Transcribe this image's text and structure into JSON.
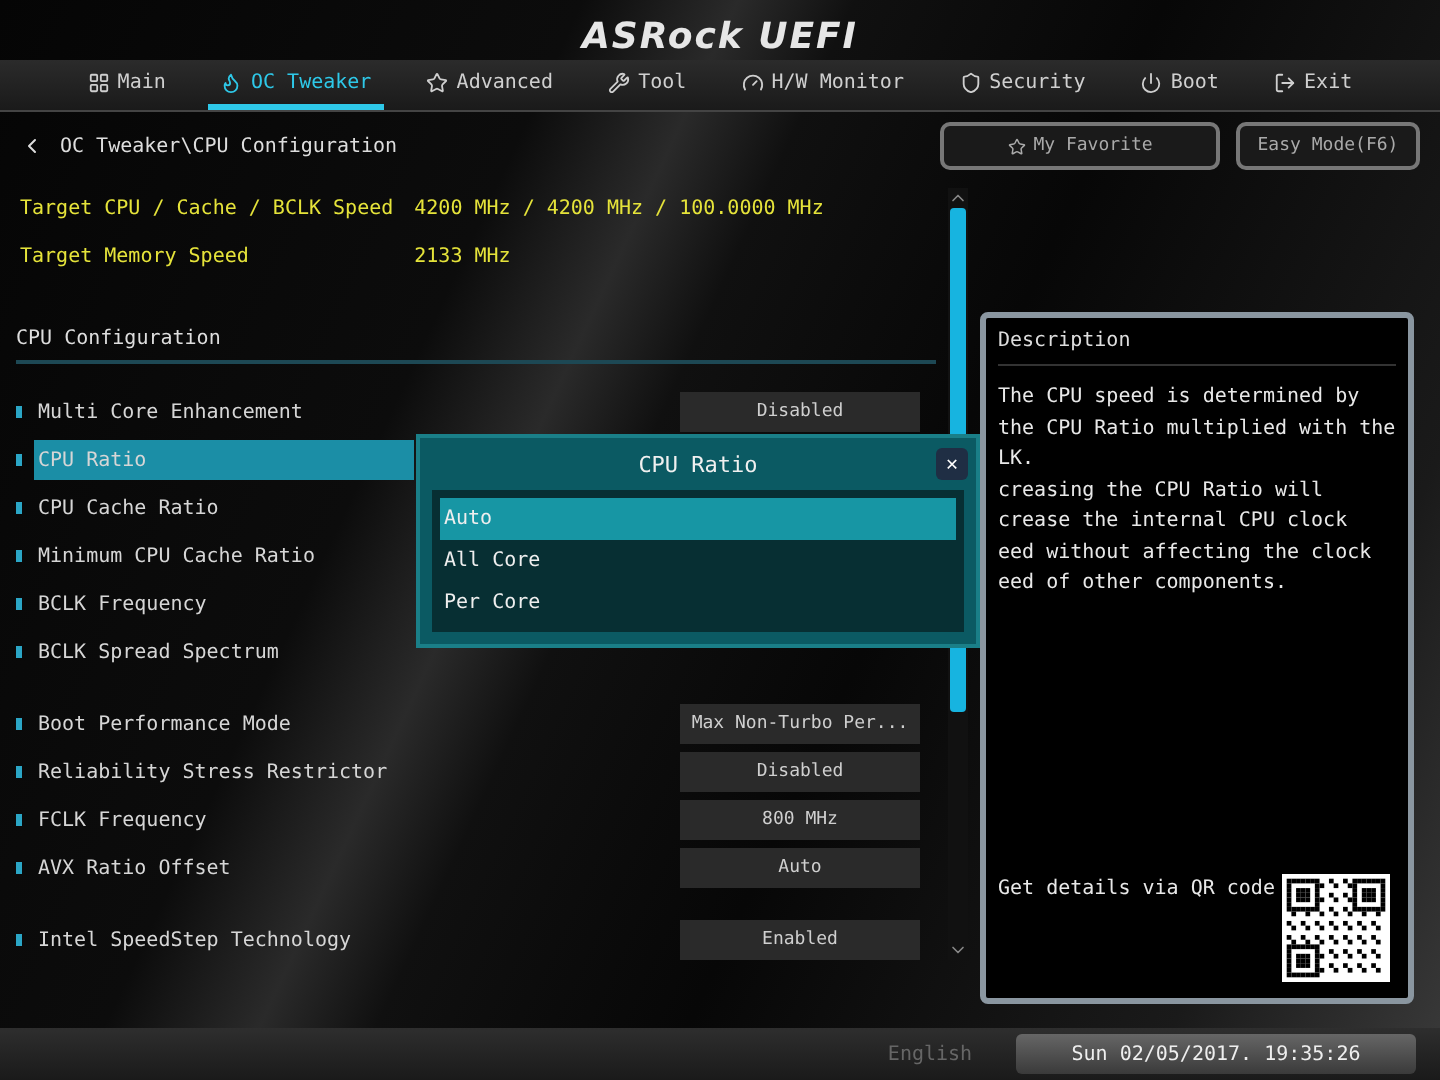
{
  "logo": "ASRock UEFI",
  "nav": [
    {
      "label": "Main",
      "selected": false
    },
    {
      "label": "OC Tweaker",
      "selected": true
    },
    {
      "label": "Advanced",
      "selected": false
    },
    {
      "label": "Tool",
      "selected": false
    },
    {
      "label": "H/W Monitor",
      "selected": false
    },
    {
      "label": "Security",
      "selected": false
    },
    {
      "label": "Boot",
      "selected": false
    },
    {
      "label": "Exit",
      "selected": false
    }
  ],
  "breadcrumb": "OC Tweaker\\CPU Configuration",
  "favorite_button": "My Favorite",
  "easy_mode_button": "Easy Mode(F6)",
  "groups": [
    {
      "rows": [
        {
          "kind": "info",
          "label": "Target CPU / Cache / BCLK Speed",
          "value": "4200 MHz / 4200 MHz / 100.0000 MHz"
        },
        {
          "kind": "info",
          "label": "Target Memory Speed",
          "value": "2133 MHz"
        }
      ]
    },
    {
      "rows": [
        {
          "kind": "heading",
          "label": "CPU Configuration"
        }
      ]
    },
    {
      "rows": [
        {
          "kind": "setting",
          "label": "Multi Core Enhancement",
          "value": "Disabled",
          "selected": false
        },
        {
          "kind": "setting",
          "label": "CPU Ratio",
          "selected": true
        },
        {
          "kind": "setting",
          "label": "CPU Cache Ratio",
          "selected": false
        },
        {
          "kind": "setting",
          "label": "Minimum CPU Cache Ratio",
          "selected": false
        },
        {
          "kind": "setting",
          "label": "BCLK Frequency",
          "selected": false
        },
        {
          "kind": "setting",
          "label": "BCLK Spread Spectrum",
          "selected": false
        }
      ]
    },
    {
      "rows": [
        {
          "kind": "setting",
          "label": "Boot Performance Mode",
          "value": "Max Non-Turbo Per...",
          "selected": false
        },
        {
          "kind": "setting",
          "label": "Reliability Stress Restrictor",
          "value": "Disabled",
          "selected": false
        },
        {
          "kind": "setting",
          "label": "FCLK Frequency",
          "value": "800 MHz",
          "selected": false
        },
        {
          "kind": "setting",
          "label": "AVX Ratio Offset",
          "value": "Auto",
          "selected": false
        }
      ]
    },
    {
      "rows": [
        {
          "kind": "setting",
          "label": "Intel SpeedStep Technology",
          "value": "Enabled",
          "selected": false
        }
      ]
    }
  ],
  "popup": {
    "title": "CPU Ratio",
    "close": "✕",
    "options": [
      {
        "label": "Auto",
        "selected": true
      },
      {
        "label": "All Core",
        "selected": false
      },
      {
        "label": "Per Core",
        "selected": false
      }
    ]
  },
  "description": {
    "title": "Description",
    "lines": [
      "The CPU speed is determined by",
      "the CPU Ratio multiplied with the",
      "LK.",
      "creasing the CPU Ratio will",
      "crease the internal CPU clock",
      "eed without affecting the clock",
      "eed of other components."
    ],
    "qr_label": "Get details via QR code"
  },
  "status_bar": {
    "language": "English",
    "datetime": "Sun 02/05/2017. 19:35:26"
  }
}
